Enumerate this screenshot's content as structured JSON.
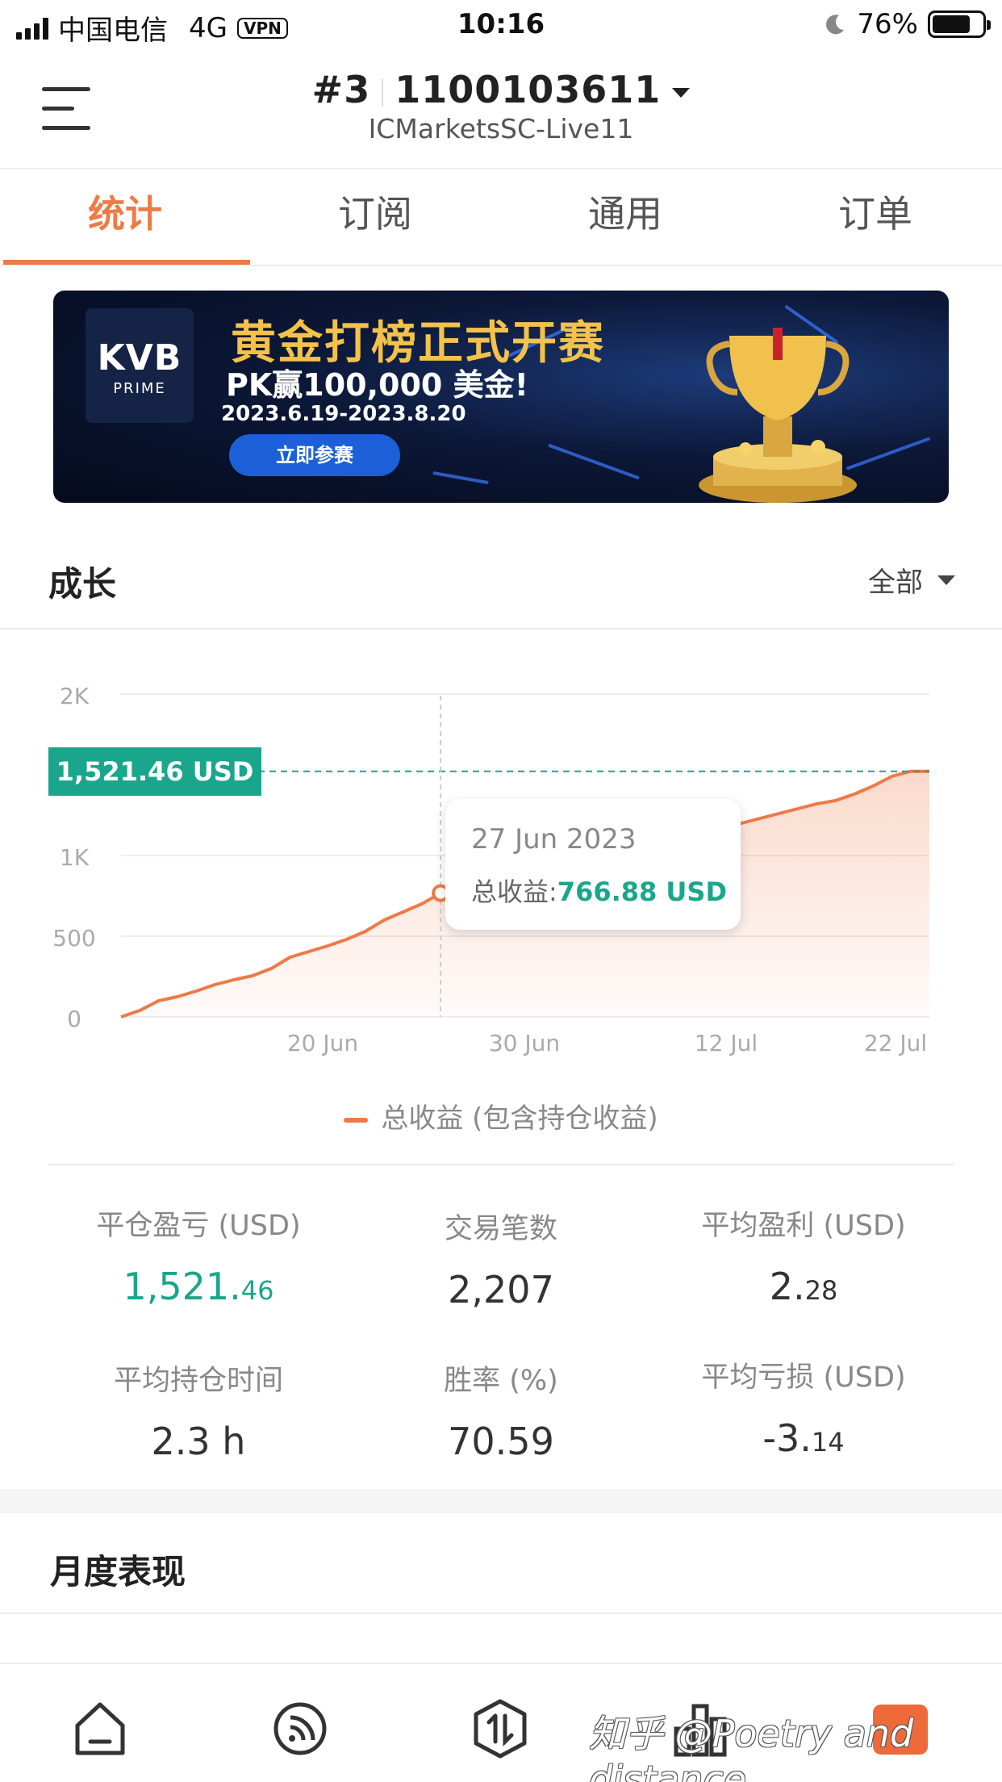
{
  "status_bar": {
    "carrier": "中国电信",
    "network": "4G",
    "vpn": "VPN",
    "time": "10:16",
    "battery": "76%",
    "battery_level": 0.76
  },
  "header": {
    "account_number": "#3",
    "account_id": "1100103611",
    "server": "ICMarketsSC-Live11"
  },
  "tabs": [
    {
      "label": "统计",
      "active": true
    },
    {
      "label": "订阅",
      "active": false
    },
    {
      "label": "通用",
      "active": false
    },
    {
      "label": "订单",
      "active": false
    }
  ],
  "banner": {
    "logo_main": "KVB",
    "logo_sub": "PRIME",
    "title": "黄金打榜正式开赛",
    "subtitle": "PK赢100,000 美金!",
    "dates": "2023.6.19-2023.8.20",
    "button": "立即参赛"
  },
  "growth": {
    "title": "成长",
    "range": "全部"
  },
  "chart_data": {
    "type": "area",
    "x_ticks": [
      "20 Jun",
      "30 Jun",
      "12 Jul",
      "22 Jul"
    ],
    "y_ticks": [
      "0",
      "500",
      "1K",
      "2K"
    ],
    "series": [
      {
        "name": "总收益 (包含持仓收益)",
        "color": "#ee7a47",
        "x": [
          "10 Jun",
          "11 Jun",
          "12 Jun",
          "13 Jun",
          "14 Jun",
          "15 Jun",
          "16 Jun",
          "17 Jun",
          "18 Jun",
          "19 Jun",
          "20 Jun",
          "21 Jun",
          "22 Jun",
          "23 Jun",
          "24 Jun",
          "25 Jun",
          "26 Jun",
          "27 Jun",
          "28 Jun",
          "29 Jun",
          "30 Jun",
          "1 Jul",
          "2 Jul",
          "3 Jul",
          "4 Jul",
          "5 Jul",
          "6 Jul",
          "7 Jul",
          "8 Jul",
          "9 Jul",
          "10 Jul",
          "11 Jul",
          "12 Jul",
          "13 Jul",
          "14 Jul",
          "15 Jul",
          "16 Jul",
          "17 Jul",
          "18 Jul",
          "19 Jul",
          "20 Jul",
          "21 Jul",
          "22 Jul",
          "23 Jul"
        ],
        "y": [
          0,
          40,
          100,
          125,
          160,
          200,
          230,
          255,
          300,
          370,
          405,
          440,
          480,
          530,
          600,
          650,
          700,
          766.88,
          810,
          850,
          880,
          905,
          925,
          950,
          975,
          1000,
          1030,
          1060,
          1080,
          1100,
          1120,
          1140,
          1160,
          1200,
          1230,
          1260,
          1290,
          1320,
          1340,
          1380,
          1430,
          1490,
          1521.46,
          1521.46
        ]
      }
    ],
    "current_value_label": "1,521.46 USD",
    "current_value": 1521.46,
    "tooltip": {
      "date": "27 Jun 2023",
      "label": "总收益:",
      "value": "766.88 USD"
    }
  },
  "legend": {
    "label": "总收益 (包含持仓收益)"
  },
  "stats": [
    {
      "label": "平仓盈亏 (USD)",
      "main": "1,521.",
      "small": ".46",
      "green": true
    },
    {
      "label": "交易笔数",
      "main": "2,207",
      "small": ""
    },
    {
      "label": "平均盈利 (USD)",
      "main": "2.",
      "small": "28"
    },
    {
      "label": "平均持仓时间",
      "main": "2.3 h",
      "small": ""
    },
    {
      "label": "胜率 (%)",
      "main": "70.59",
      "small": ""
    },
    {
      "label": "平均亏损 (USD)",
      "main": "-3.",
      "small": "14"
    }
  ],
  "monthly": {
    "title": "月度表现"
  },
  "bottom_nav": {
    "items": [
      "home-icon",
      "subscribe-icon",
      "trade-icon",
      "stats-icon"
    ],
    "watermark": "知乎 @Poetry and distance"
  }
}
